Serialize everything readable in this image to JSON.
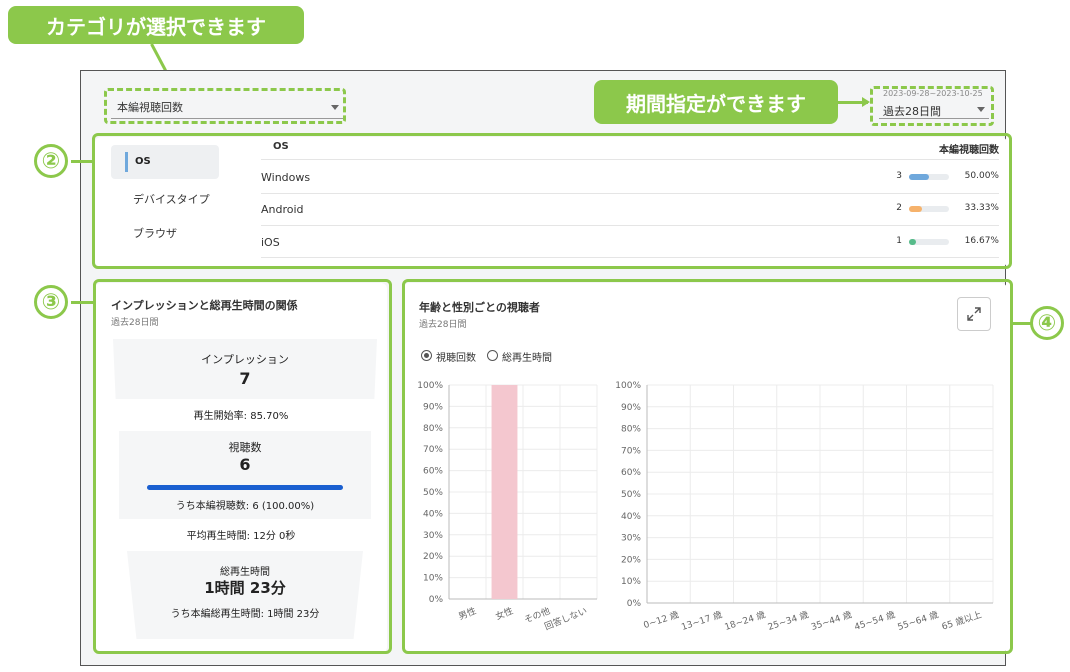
{
  "callouts": {
    "category": "カテゴリが選択できます",
    "period": "期間指定ができます",
    "n2": "②",
    "n3": "③",
    "n4": "④"
  },
  "header": {
    "category_select": "本編視聴回数",
    "date_range": "2023-09-28~2023-10-25",
    "period_select": "過去28日間"
  },
  "breakdown": {
    "tabs": [
      "OS",
      "デバイスタイプ",
      "ブラウザ"
    ],
    "active_tab": "OS",
    "col_header_left": "OS",
    "col_header_right": "本編視聴回数",
    "rows": [
      {
        "name": "Windows",
        "count": "3",
        "pct": "50.00%",
        "fraction": 0.5,
        "color": "#6fa8dc"
      },
      {
        "name": "Android",
        "count": "2",
        "pct": "33.33%",
        "fraction": 0.3333,
        "color": "#f6b26b"
      },
      {
        "name": "iOS",
        "count": "1",
        "pct": "16.67%",
        "fraction": 0.1667,
        "color": "#57bb8a"
      }
    ]
  },
  "funnel": {
    "title": "インプレッションと総再生時間の関係",
    "subtitle": "過去28日間",
    "impressions_label": "インプレッション",
    "impressions_value": "7",
    "play_rate": "再生開始率: 85.70%",
    "views_label": "視聴数",
    "views_value": "6",
    "views_progress": 1.0,
    "main_views": "うち本編視聴数: 6 (100.00%)",
    "avg_time": "平均再生時間: 12分 0秒",
    "total_label": "総再生時間",
    "total_value": "1時間 23分",
    "main_total": "うち本編総再生時間: 1時間 23分"
  },
  "demographics": {
    "title": "年齢と性別ごとの視聴者",
    "subtitle": "過去28日間",
    "radio_views": "視聴回数",
    "radio_time": "総再生時間",
    "selected": "視聴回数",
    "expand_icon": "expand-icon"
  },
  "chart_data": [
    {
      "type": "bar",
      "categories": [
        "男性",
        "女性",
        "その他",
        "回答しない"
      ],
      "values": [
        0,
        100,
        0,
        0
      ],
      "ylim": [
        0,
        100
      ],
      "yticks": [
        "0%",
        "10%",
        "20%",
        "30%",
        "40%",
        "50%",
        "60%",
        "70%",
        "80%",
        "90%",
        "100%"
      ],
      "color": "#f4c7cf",
      "grid": true
    },
    {
      "type": "bar",
      "categories": [
        "0~12 歳",
        "13~17 歳",
        "18~24 歳",
        "25~34 歳",
        "35~44 歳",
        "45~54 歳",
        "55~64 歳",
        "65 歳以上"
      ],
      "values": [
        0,
        0,
        0,
        0,
        0,
        0,
        0,
        0
      ],
      "ylim": [
        0,
        100
      ],
      "yticks": [
        "0%",
        "10%",
        "20%",
        "30%",
        "40%",
        "50%",
        "60%",
        "70%",
        "80%",
        "90%",
        "100%"
      ],
      "grid": true
    }
  ]
}
